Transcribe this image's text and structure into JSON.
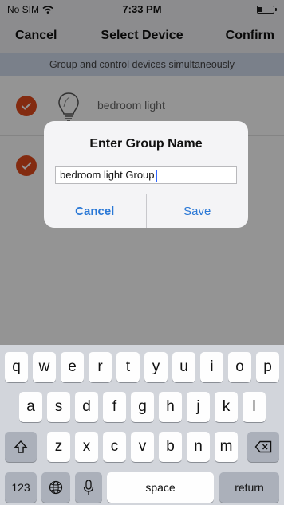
{
  "status_bar": {
    "carrier": "No SIM",
    "time": "7:33 PM"
  },
  "nav": {
    "cancel": "Cancel",
    "title": "Select Device",
    "confirm": "Confirm"
  },
  "banner": "Group and control devices simultaneously",
  "devices": [
    {
      "label": "bedroom light",
      "checked": true
    },
    {
      "label": "",
      "checked": true
    }
  ],
  "dialog": {
    "title": "Enter Group Name",
    "input_value": "bedroom light Group",
    "cancel": "Cancel",
    "save": "Save"
  },
  "keyboard": {
    "row1": [
      "q",
      "w",
      "e",
      "r",
      "t",
      "y",
      "u",
      "i",
      "o",
      "p"
    ],
    "row2": [
      "a",
      "s",
      "d",
      "f",
      "g",
      "h",
      "j",
      "k",
      "l"
    ],
    "row3": [
      "z",
      "x",
      "c",
      "v",
      "b",
      "n",
      "m"
    ],
    "numbers": "123",
    "space": "space",
    "return": "return"
  },
  "colors": {
    "accent_check": "#e24a1c",
    "dialog_button": "#2a78d6",
    "banner_bg": "#d2dcee"
  }
}
